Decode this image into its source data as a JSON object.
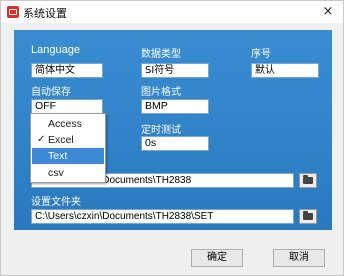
{
  "window": {
    "title": "系统设置",
    "close_glyph": "×"
  },
  "settings": {
    "language_label": "Language",
    "language_value": "简体中文",
    "datatype_label": "数据类型",
    "datatype_value": "SI符号",
    "serial_label": "序号",
    "serial_value": "默认",
    "autosave_label": "自动保存",
    "autosave_value": "OFF",
    "image_format_label": "图片格式",
    "image_format_value": "BMP",
    "timed_test_label": "定时测试",
    "timed_test_value": "0s",
    "data_path_value": "C:\\Users\\czxin\\Documents\\TH2838",
    "settings_folder_label": "设置文件夹",
    "settings_folder_value": "C:\\Users\\czxin\\Documents\\TH2838\\SET"
  },
  "dropdown": {
    "items": [
      {
        "label": "Access",
        "checked": false,
        "highlighted": false
      },
      {
        "label": "Excel",
        "checked": true,
        "highlighted": false
      },
      {
        "label": "Text",
        "checked": false,
        "highlighted": true
      },
      {
        "label": "csv",
        "checked": false,
        "highlighted": false
      }
    ],
    "check_glyph": "✓"
  },
  "buttons": {
    "ok_label": "确定",
    "cancel_label": "取消"
  },
  "colors": {
    "panel": "#2e83c9",
    "highlight": "#3c8ad6",
    "app_icon": "#d8322b"
  },
  "icons": {
    "app": "app-icon",
    "close": "close-icon",
    "browse": "folder-icon"
  }
}
